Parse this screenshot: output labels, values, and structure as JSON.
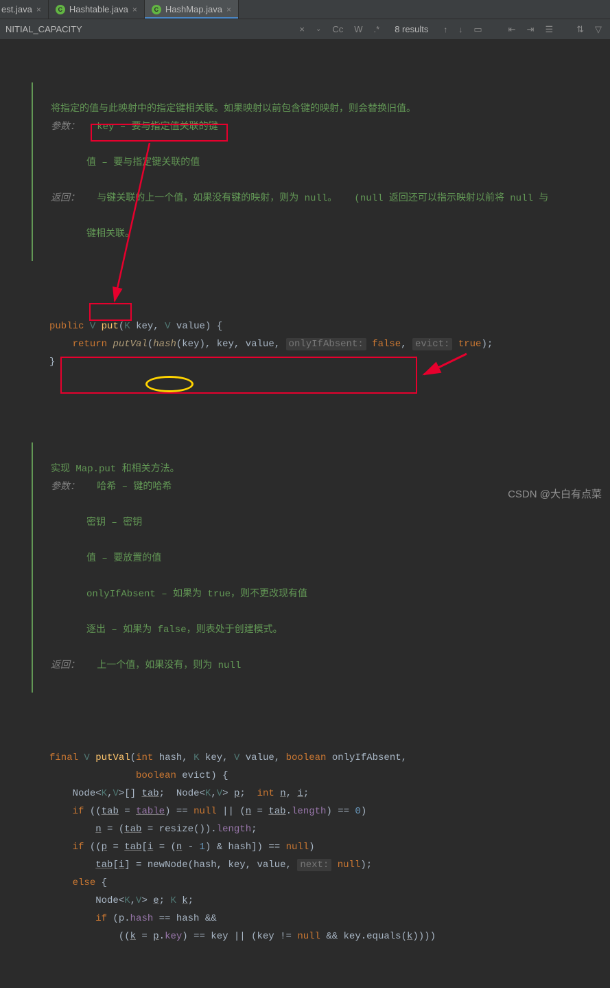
{
  "tabs": [
    {
      "label": "est.java",
      "active": false,
      "partial": true
    },
    {
      "label": "Hashtable.java",
      "active": false
    },
    {
      "label": "HashMap.java",
      "active": true
    }
  ],
  "find": {
    "query": "NITIAL_CAPACITY",
    "cc_label": "Cc",
    "w_label": "W",
    "results": "8 results"
  },
  "doc1": {
    "line1": "将指定的值与此映射中的指定键相关联。如果映射以前包含键的映射，则会替换旧值。",
    "params_label": "参数：",
    "param_key": "key – 要与指定值关联的键",
    "param_value": "值 – 要与指定键关联的值",
    "returns_label": "返回：",
    "returns_text1": "与键关联的上一个值，如果没有键的映射，则为 null。   (null 返回还可以指示映射以前将 null 与",
    "returns_text2": "键相关联。"
  },
  "put": {
    "kw_public": "public",
    "ret_type": "V",
    "name": "put",
    "p1t": "K",
    "p1n": "key",
    "p2t": "V",
    "p2n": "value",
    "kw_return": "return",
    "call": "putVal",
    "hash_call": "hash",
    "arg_key": "key",
    "arg_value": "value",
    "hint_onlyIf": "onlyIfAbsent:",
    "val_false": "false",
    "hint_evict": "evict:",
    "val_true": "true"
  },
  "doc2": {
    "line1": "实现 Map.put 和相关方法。",
    "params_label": "参数：",
    "p_hash": "哈希 – 键的哈希",
    "p_key": "密钥 – 密钥",
    "p_value": "值 – 要放置的值",
    "p_onlyIf": "onlyIfAbsent – 如果为 true，则不更改现有值",
    "p_evict": "逐出 – 如果为 false，则表处于创建模式。",
    "returns_label": "返回：",
    "returns_text": "上一个值，如果没有，则为 null"
  },
  "putVal": {
    "kw_final": "final",
    "ret_type": "V",
    "name": "putVal",
    "kw_int": "int",
    "p_hash": "hash",
    "p_kt": "K",
    "p_key": "key",
    "p_vt": "V",
    "p_value": "value",
    "kw_boolean": "boolean",
    "p_onlyIf": "onlyIfAbsent",
    "p_evict": "evict",
    "node": "Node",
    "tab": "tab",
    "p": "p",
    "n": "n",
    "i": "i",
    "kw_if": "if",
    "table": "table",
    "kw_null": "null",
    "length": "length",
    "resize": "resize",
    "newNode": "newNode",
    "hint_next": "next:",
    "kw_else": "else",
    "e": "e",
    "k": "k",
    "hash_field": "hash",
    "key_field": "key",
    "equals": "equals"
  },
  "watermark": "CSDN @大白有点菜"
}
